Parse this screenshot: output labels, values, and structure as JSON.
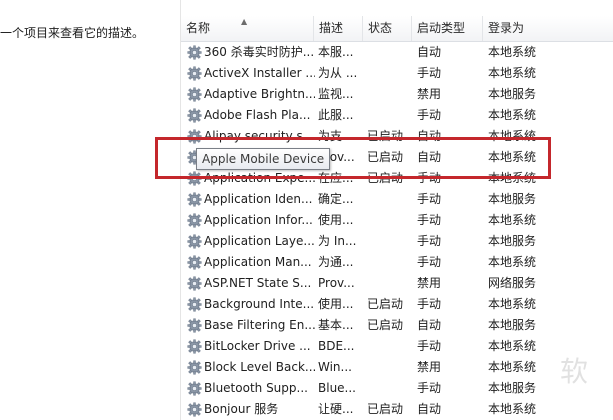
{
  "description_pane": {
    "text": "一个项目来查看它的描述。"
  },
  "columns": {
    "name": "名称",
    "description": "描述",
    "status": "状态",
    "startup_type": "启动类型",
    "logon_as": "登录为"
  },
  "icons": {
    "service": "gear-icon",
    "sort": "sort-up-icon"
  },
  "services": [
    {
      "name": "360 杀毒实时防护...",
      "description": "本服...",
      "status": "",
      "startup_type": "自动",
      "logon_as": "本地系统"
    },
    {
      "name": "ActiveX Installer ...",
      "description": "为从 ...",
      "status": "",
      "startup_type": "手动",
      "logon_as": "本地系统"
    },
    {
      "name": "Adaptive Brightn...",
      "description": "监视...",
      "status": "",
      "startup_type": "禁用",
      "logon_as": "本地服务"
    },
    {
      "name": "Adobe Flash Pla...",
      "description": "此服...",
      "status": "",
      "startup_type": "手动",
      "logon_as": "本地系统"
    },
    {
      "name": "Alipay security s...",
      "description": "为支...",
      "status": "已启动",
      "startup_type": "自动",
      "logon_as": "本地系统"
    },
    {
      "name": "",
      "description": "Prov...",
      "status": "已启动",
      "startup_type": "自动",
      "logon_as": "本地系统"
    },
    {
      "name": "Application Expe...",
      "description": "在应...",
      "status": "已启动",
      "startup_type": "手动",
      "logon_as": "本地系统"
    },
    {
      "name": "Application Iden...",
      "description": "确定...",
      "status": "",
      "startup_type": "手动",
      "logon_as": "本地服务"
    },
    {
      "name": "Application Infor...",
      "description": "使用...",
      "status": "",
      "startup_type": "手动",
      "logon_as": "本地系统"
    },
    {
      "name": "Application Laye...",
      "description": "为 In...",
      "status": "",
      "startup_type": "手动",
      "logon_as": "本地服务"
    },
    {
      "name": "Application Man...",
      "description": "为通...",
      "status": "",
      "startup_type": "手动",
      "logon_as": "本地系统"
    },
    {
      "name": "ASP.NET State S...",
      "description": "Prov...",
      "status": "",
      "startup_type": "禁用",
      "logon_as": "网络服务"
    },
    {
      "name": "Background Inte...",
      "description": "使用...",
      "status": "已启动",
      "startup_type": "手动",
      "logon_as": "本地系统"
    },
    {
      "name": "Base Filtering En...",
      "description": "基本...",
      "status": "已启动",
      "startup_type": "自动",
      "logon_as": "本地服务"
    },
    {
      "name": "BitLocker Drive ...",
      "description": "BDE...",
      "status": "",
      "startup_type": "手动",
      "logon_as": "本地系统"
    },
    {
      "name": "Block Level Back...",
      "description": "Win...",
      "status": "",
      "startup_type": "禁用",
      "logon_as": "本地系统"
    },
    {
      "name": "Bluetooth Supp...",
      "description": "Blue...",
      "status": "",
      "startup_type": "手动",
      "logon_as": "本地服务"
    },
    {
      "name": "Bonjour 服务",
      "description": "让硬...",
      "status": "已启动",
      "startup_type": "自动",
      "logon_as": "本地系统"
    }
  ],
  "tooltip": {
    "text": "Apple Mobile Device"
  },
  "watermark": {
    "text": "软"
  },
  "colors": {
    "highlight": "#c4272c",
    "row_selected": "#cfe6fb"
  }
}
